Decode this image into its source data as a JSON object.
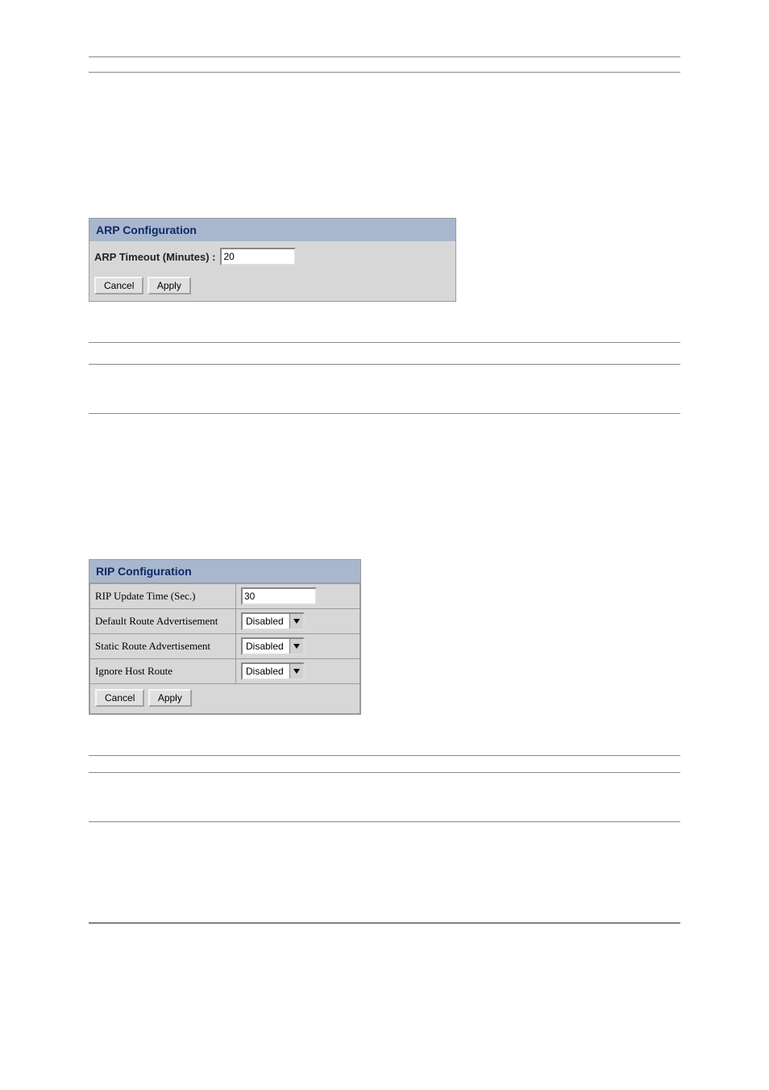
{
  "arp": {
    "title": "ARP Configuration",
    "timeout_label": "ARP Timeout (Minutes) :",
    "timeout_value": "20",
    "cancel": "Cancel",
    "apply": "Apply"
  },
  "rip": {
    "title": "RIP Configuration",
    "rows": {
      "update_time_label": "RIP Update Time (Sec.)",
      "update_time_value": "30",
      "default_route_label": "Default Route Advertisement",
      "default_route_value": "Disabled",
      "static_route_label": "Static Route Advertisement",
      "static_route_value": "Disabled",
      "ignore_host_label": "Ignore Host Route",
      "ignore_host_value": "Disabled"
    },
    "cancel": "Cancel",
    "apply": "Apply"
  }
}
